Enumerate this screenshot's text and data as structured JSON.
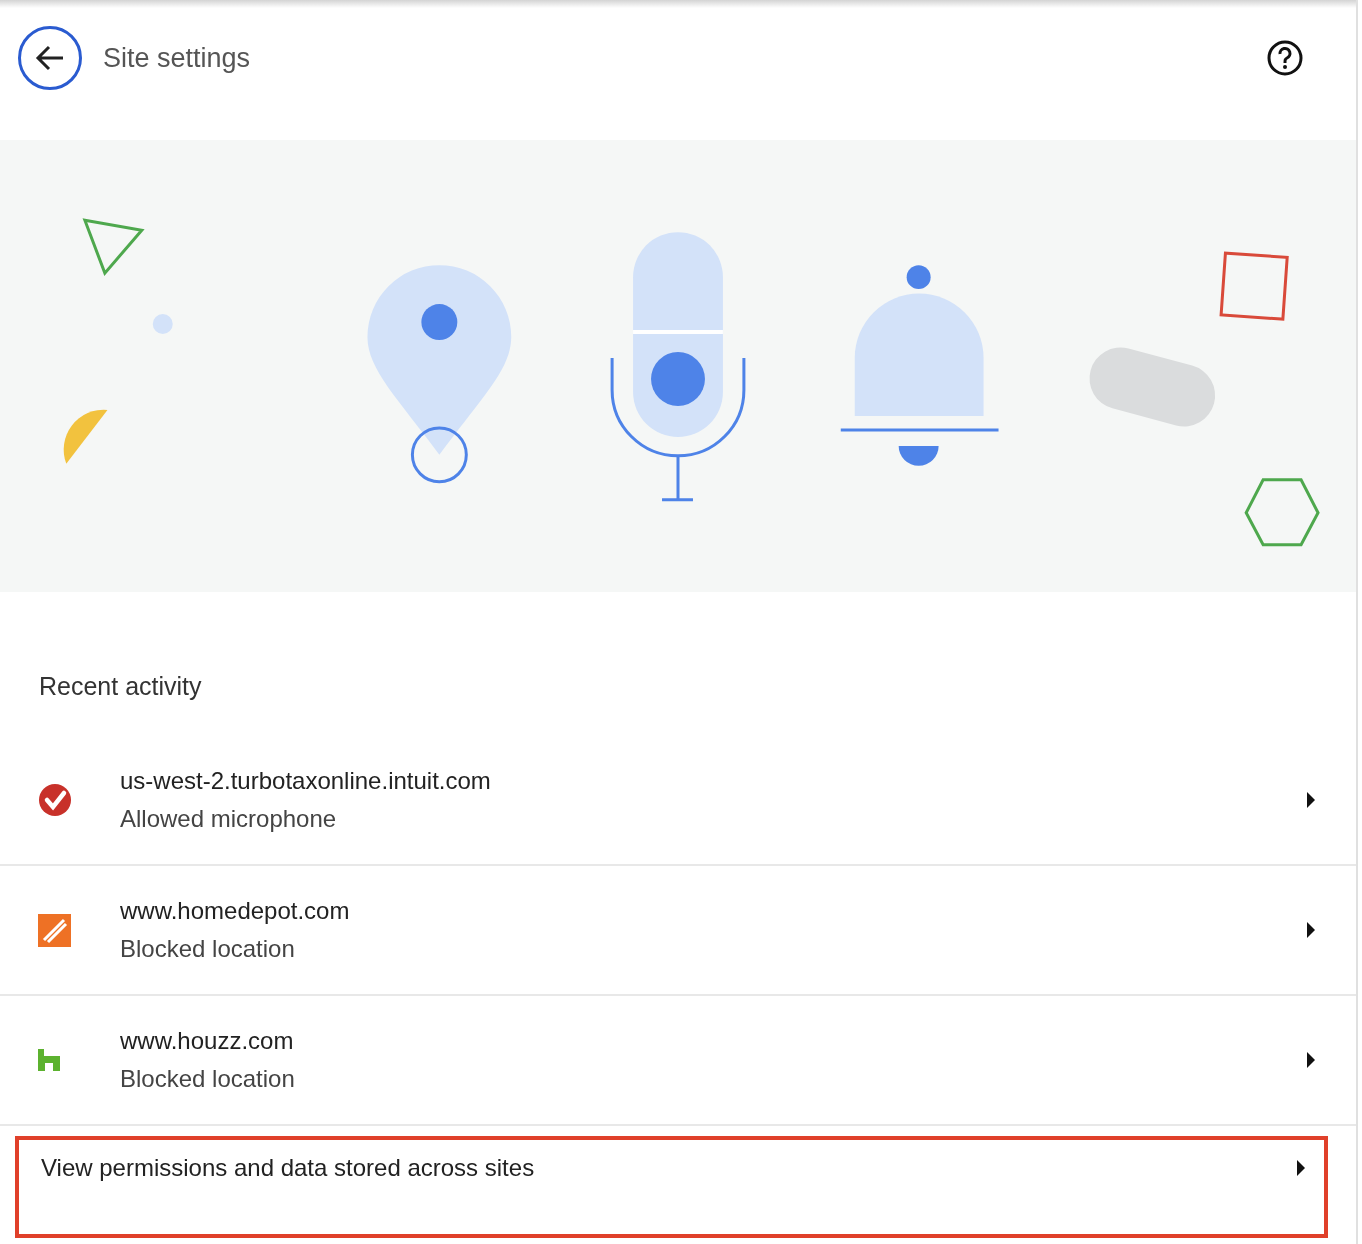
{
  "header": {
    "title": "Site settings"
  },
  "section_title": "Recent activity",
  "sites": [
    {
      "kind": "check",
      "domain": "us-west-2.turbotaxonline.intuit.com",
      "status": "Allowed microphone"
    },
    {
      "kind": "homedepot",
      "domain": "www.homedepot.com",
      "status": "Blocked location"
    },
    {
      "kind": "houzz",
      "domain": "www.houzz.com",
      "status": "Blocked location"
    }
  ],
  "all_sites_link": {
    "label": "View permissions and data stored across sites",
    "highlighted": true
  }
}
